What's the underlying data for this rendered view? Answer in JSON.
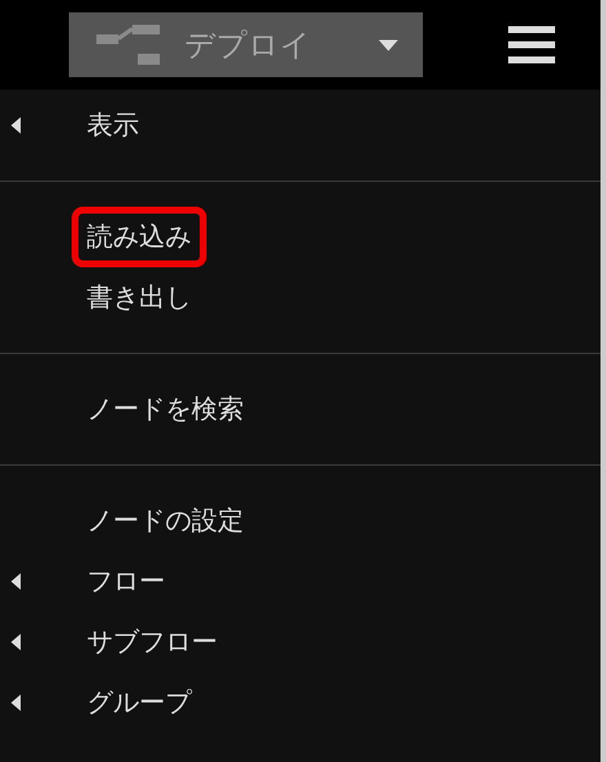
{
  "header": {
    "deploy_button": {
      "label": "デプロイ"
    }
  },
  "menu": {
    "groups": [
      {
        "items": [
          {
            "label": "表示",
            "has_submenu": true,
            "highlighted": false
          }
        ]
      },
      {
        "items": [
          {
            "label": "読み込み",
            "has_submenu": false,
            "highlighted": true
          },
          {
            "label": "書き出し",
            "has_submenu": false,
            "highlighted": false
          }
        ]
      },
      {
        "items": [
          {
            "label": "ノードを検索",
            "has_submenu": false,
            "highlighted": false
          }
        ]
      },
      {
        "items": [
          {
            "label": "ノードの設定",
            "has_submenu": false,
            "highlighted": false
          },
          {
            "label": "フロー",
            "has_submenu": true,
            "highlighted": false
          },
          {
            "label": "サブフロー",
            "has_submenu": true,
            "highlighted": false
          },
          {
            "label": "グループ",
            "has_submenu": true,
            "highlighted": false
          }
        ]
      }
    ]
  }
}
